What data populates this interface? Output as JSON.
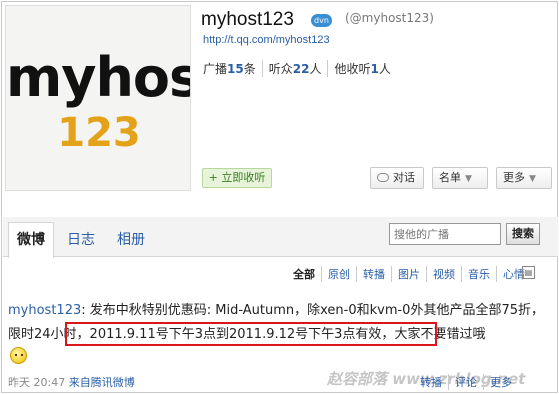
{
  "profile": {
    "name": "myhost123",
    "badge": "dvn",
    "handle": "(@myhost123)",
    "url": "http://t.qq.com/myhost123",
    "avatar_line1": "myhost",
    "avatar_line2": "123",
    "stats": [
      {
        "label_pre": "广播",
        "count": "15",
        "label_post": "条"
      },
      {
        "label_pre": "听众",
        "count": "22",
        "label_post": "人"
      },
      {
        "label_pre": "他收听",
        "count": "1",
        "label_post": "人"
      }
    ],
    "follow_label": "+ 立即收听",
    "talk_label": "对话",
    "list_label": "名单",
    "more_label": "更多"
  },
  "tabs": {
    "weibo": "微博",
    "log": "日志",
    "album": "相册"
  },
  "search": {
    "placeholder": "搜他的广播",
    "button": "搜索"
  },
  "filters": [
    "全部",
    "原创",
    "转播",
    "图片",
    "视频",
    "音乐",
    "心情"
  ],
  "post": {
    "author": "myhost123",
    "text_before": ": 发布中秋特别优惠码: Mid-Autumn，除xen-0和kvm-0外其他产品全部75折，限时",
    "text_highlight": "24小时，2011.9.11号下午3点到2011.9.12号下午3点有效，",
    "text_after": "大家不要错过哦",
    "time": "昨天 20:47",
    "source": "来自腾讯微博",
    "actions": [
      "转播",
      "评论",
      "更多"
    ]
  },
  "watermark": "赵容部落 www.zrblog.net",
  "colors": {
    "link": "#2a5fa8",
    "highlight_border": "#d8161b",
    "follow_green": "#3a7d22"
  }
}
